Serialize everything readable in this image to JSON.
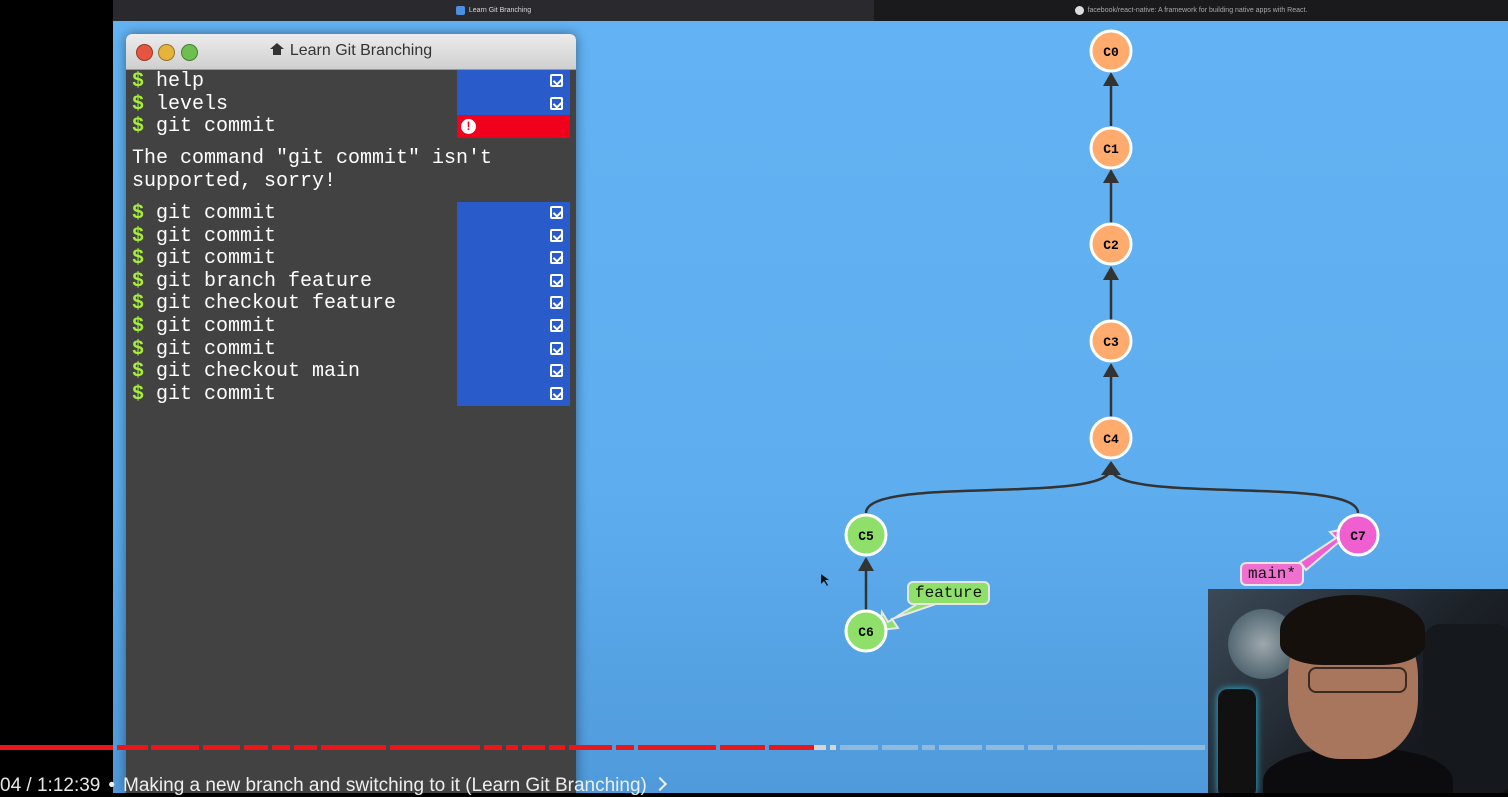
{
  "browser": {
    "tabs": [
      {
        "label": "Learn Git Branching"
      },
      {
        "label": "facebook/react-native: A framework for building native apps with React."
      }
    ]
  },
  "console": {
    "title": "Learn Git Branching",
    "entries": [
      {
        "cmd": "help",
        "status": "ok"
      },
      {
        "cmd": "levels",
        "status": "ok"
      },
      {
        "cmd": "git commit",
        "status": "error"
      }
    ],
    "error_message": "The command \"git commit\" isn't supported, sorry!",
    "entries2": [
      {
        "cmd": "git commit",
        "status": "ok"
      },
      {
        "cmd": "git commit",
        "status": "ok"
      },
      {
        "cmd": "git commit",
        "status": "ok"
      },
      {
        "cmd": "git branch feature",
        "status": "ok"
      },
      {
        "cmd": "git checkout feature",
        "status": "ok"
      },
      {
        "cmd": "git commit",
        "status": "ok"
      },
      {
        "cmd": "git commit",
        "status": "ok"
      },
      {
        "cmd": "git checkout main",
        "status": "ok"
      },
      {
        "cmd": "git commit",
        "status": "ok"
      }
    ],
    "prompt": "$"
  },
  "graph": {
    "commits": [
      "C0",
      "C1",
      "C2",
      "C3",
      "C4",
      "C5",
      "C6",
      "C7"
    ],
    "branches": [
      {
        "name": "feature",
        "target": "C6",
        "color": "#8fe06a"
      },
      {
        "name": "main*",
        "target": "C7",
        "color": "#f070d0"
      }
    ],
    "colors": {
      "main_line": "#ffab6e",
      "feature": "#8fe06a",
      "main_tip": "#f05fd0"
    }
  },
  "video": {
    "time": "04 / 1:12:39",
    "separator": "•",
    "chapter": "Making a new branch and switching to it (Learn Git Branching)"
  }
}
